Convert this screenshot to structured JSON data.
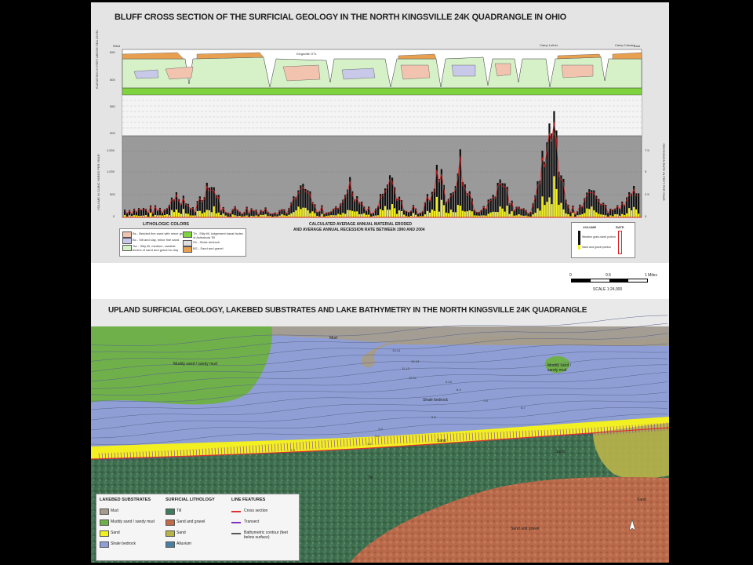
{
  "top": {
    "title": "BLUFF CROSS SECTION OF THE SURFICIAL GEOLOGY IN THE NORTH KINGSVILLE 24K QUADRANGLE IN OHIO",
    "west": "West",
    "east": "East",
    "kingsville_otl": "Kingsville OTL",
    "camp_luther": "Camp Luther",
    "camp_calvary": "Camp Calvary",
    "elev_label": "ELEVATION IN FEET ABOVE SEA LEVEL",
    "elev_ticks": [
      "650",
      "600",
      "550",
      "500"
    ],
    "vol_label": "VOLUME IN CUBIC YARDS PER YEAR",
    "vol_ticks": [
      "1,500",
      "1,000",
      "500",
      "0"
    ],
    "rate_label": "RECESSION RATE IN FEET PER YEAR",
    "rate_ticks": [
      "7.5",
      "5",
      "2.5",
      "0"
    ],
    "calc_line1": "CALCULATED AVERAGE ANNUAL MATERIAL ERODED",
    "calc_line2": "AND AVERAGE ANNUAL RECESSION RATE BETWEEN 1990 AND 2004",
    "lith_title": "LITHOLOGIC COLORS",
    "lith_items": [
      {
        "label": "Bs - Bedded fine sand with minor gravel",
        "color": "#f2c4b0"
      },
      {
        "label": "Bc - Silt and clay, minor fine sand",
        "color": "#c8c8e8"
      },
      {
        "label": "Tsv - Silty till, medium, variable lenses of sand and gravel to clay",
        "color": "#d6f0c8"
      },
      {
        "label": "Tb - Silty till, lodgement basal facies of Ashtabula Till",
        "color": "#7fd33f"
      },
      {
        "label": "Sh - Shale bedrock",
        "color": "#dddddd"
      },
      {
        "label": "BG - Sand and gravel",
        "color": "#e8a050"
      }
    ],
    "vol_legend_title": "VOLUME",
    "rate_legend_title": "RATE",
    "vol_legend_items": [
      "Weather grain-sized portion",
      "Sand and gravel portion"
    ]
  },
  "scale": {
    "ticks": [
      "0",
      "0.5",
      "1 Miles"
    ],
    "text": "SCALE  1:24,000"
  },
  "bottom": {
    "title": "UPLAND SURFICIAL GEOLOGY, LAKEBED SUBSTRATES AND LAKE BATHYMETRY IN THE NORTH KINGSVILLE 24K QUADRANGLE",
    "labels": {
      "mud": "Mud",
      "muddy_sand_w": "Muddy sand / sandy mud",
      "muddy_sand_e": "Muddy sand / sandy mud",
      "shale_bedrock": "Shale bedrock",
      "sand_center": "Sand",
      "sand_e": "Sand",
      "sand_far_e": "Sand",
      "till": "Till",
      "sand_gravel": "Sand and gravel"
    },
    "contours": [
      "13-14",
      "12-13",
      "11-12",
      "10-11",
      "9-10",
      "8-9",
      "7-8",
      "6-7",
      "5-6",
      "4-5",
      "3-4",
      "2-3",
      "1-2"
    ],
    "legend": {
      "lakebed_title": "LAKEBED SUBSTRATES",
      "lakebed_items": [
        {
          "label": "Mud",
          "color": "#a59c8c"
        },
        {
          "label": "Muddy sand / sandy mud",
          "color": "#6fb04a"
        },
        {
          "label": "Sand",
          "color": "#f2f020"
        },
        {
          "label": "Shale bedrock",
          "color": "#8f9fd6"
        }
      ],
      "surficial_title": "SURFICIAL LITHOLOGY",
      "surficial_items": [
        {
          "label": "Till",
          "color": "#3f7a5c"
        },
        {
          "label": "Sand and gravel",
          "color": "#c06a48"
        },
        {
          "label": "Sand",
          "color": "#b9b34a"
        },
        {
          "label": "Alluvium",
          "color": "#4a7fa0"
        }
      ],
      "line_title": "LINE FEATURES",
      "line_items": [
        {
          "label": "Cross section",
          "color": "#e03030"
        },
        {
          "label": "Transect",
          "color": "#8030c0"
        },
        {
          "label": "Bathymetric contour (feet below surface)",
          "color": "#555555"
        }
      ]
    },
    "north": "N"
  }
}
